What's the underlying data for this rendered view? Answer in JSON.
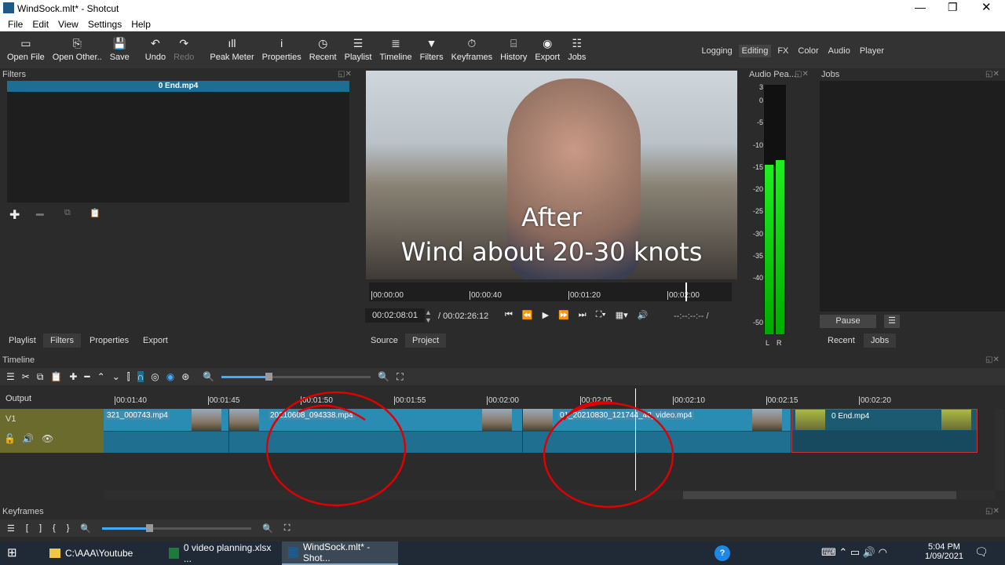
{
  "window": {
    "title": "WindSock.mlt* - Shotcut",
    "controls": [
      "minimize",
      "restore",
      "close"
    ]
  },
  "menu": [
    "File",
    "Edit",
    "View",
    "Settings",
    "Help"
  ],
  "toolbar": [
    {
      "label": "Open File",
      "icon": "folder-icon",
      "glyph": "▭"
    },
    {
      "label": "Open Other..",
      "icon": "open-other-icon",
      "glyph": "⎘"
    },
    {
      "label": "Save",
      "icon": "save-icon",
      "glyph": "💾"
    },
    {
      "label": "Undo",
      "icon": "undo-icon",
      "glyph": "↶"
    },
    {
      "label": "Redo",
      "icon": "redo-icon",
      "glyph": "↷",
      "disabled": true
    },
    {
      "label": "Peak Meter",
      "icon": "peak-meter-icon",
      "glyph": "ıll"
    },
    {
      "label": "Properties",
      "icon": "info-icon",
      "glyph": "i"
    },
    {
      "label": "Recent",
      "icon": "clock-icon",
      "glyph": "◷"
    },
    {
      "label": "Playlist",
      "icon": "list-icon",
      "glyph": "☰"
    },
    {
      "label": "Timeline",
      "icon": "timeline-icon",
      "glyph": "≣"
    },
    {
      "label": "Filters",
      "icon": "filter-icon",
      "glyph": "▼"
    },
    {
      "label": "Keyframes",
      "icon": "stopwatch-icon",
      "glyph": "⏱"
    },
    {
      "label": "History",
      "icon": "history-icon",
      "glyph": "⌸"
    },
    {
      "label": "Export",
      "icon": "export-icon",
      "glyph": "◉"
    },
    {
      "label": "Jobs",
      "icon": "jobs-icon",
      "glyph": "☷"
    }
  ],
  "layouts": {
    "items": [
      "Logging",
      "Editing",
      "FX",
      "Color",
      "Audio",
      "Player"
    ],
    "active": "Editing"
  },
  "filters": {
    "title": "Filters",
    "selected": "0 End.mp4"
  },
  "left_tabs": [
    "Playlist",
    "Filters",
    "Properties",
    "Export"
  ],
  "preview": {
    "caption_line1": "After",
    "caption_line2": "Wind about 20-30 knots",
    "ruler": [
      "00:00:00",
      "00:00:40",
      "00:01:20",
      "00:02:00"
    ],
    "current_time": "00:02:08:01",
    "total": "/ 00:02:26:12",
    "in_out": "--:--:--:-- /",
    "tabs": [
      "Source",
      "Project"
    ],
    "active_tab": "Project"
  },
  "audio_peak": {
    "title": "Audio Pea...",
    "scale": [
      "3",
      "0",
      "-5",
      "-10",
      "-15",
      "-20",
      "-25",
      "-30",
      "-35",
      "-40",
      "-50"
    ],
    "channels": [
      "L",
      "R"
    ],
    "level_db": [
      -15,
      -14
    ]
  },
  "jobs": {
    "title": "Jobs",
    "pause": "Pause",
    "tabs": [
      "Recent",
      "Jobs"
    ],
    "active_tab": "Jobs"
  },
  "timeline": {
    "title": "Timeline",
    "output": "Output",
    "track": "V1",
    "ruler": [
      "00:01:40",
      "00:01:45",
      "00:01:50",
      "00:01:55",
      "00:02:00",
      "00:02:05",
      "00:02:10",
      "00:02:15",
      "00:02:20"
    ],
    "clips": [
      {
        "name": "321_000743.mp4"
      },
      {
        "name": "20210608_094338.mp4"
      },
      {
        "name": "01_20210830_121744_48_video.mp4"
      },
      {
        "name": "0 End.mp4",
        "selected": true
      }
    ],
    "annotation_color": "#e00000"
  },
  "keyframes": {
    "title": "Keyframes",
    "buttons": [
      "[",
      "]",
      "{",
      "}"
    ]
  },
  "taskbar": {
    "items": [
      "C:\\AAA\\Youtube",
      "0 video planning.xlsx ...",
      "WindSock.mlt* - Shot..."
    ],
    "time": "5:04 PM",
    "date": "1/09/2021"
  }
}
